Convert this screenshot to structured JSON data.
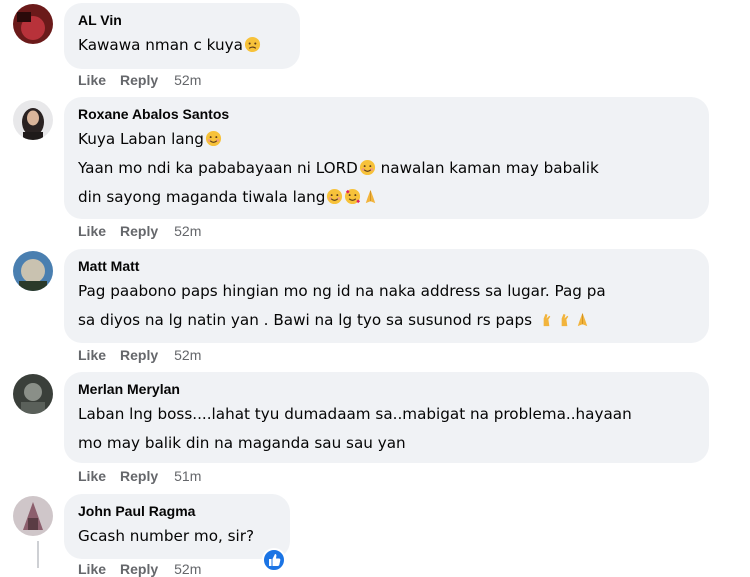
{
  "comments": [
    {
      "author": "AL Vin",
      "lines": [
        "Kawawa nman c kuya"
      ],
      "actions": {
        "like": "Like",
        "reply": "Reply",
        "time": "52m"
      }
    },
    {
      "author": "Roxane Abalos Santos",
      "lines": [
        "Kuya Laban lang",
        "Yaan mo ndi ka pababayaan ni LORD",
        " nawalan kaman may babalik",
        "din sayong maganda tiwala lang"
      ],
      "actions": {
        "like": "Like",
        "reply": "Reply",
        "time": "52m"
      }
    },
    {
      "author": "Matt Matt",
      "lines": [
        "Pag paabono paps hingian mo ng id na naka address sa lugar. Pag pa",
        "sa diyos na lg natin yan . Bawi na lg tyo sa susunod rs paps"
      ],
      "actions": {
        "like": "Like",
        "reply": "Reply",
        "time": "52m"
      }
    },
    {
      "author": "Merlan Merylan",
      "lines": [
        "Laban lng boss....lahat tyu dumadaam sa..mabigat na problema..hayaan",
        "mo may balik din na maganda sau sau yan"
      ],
      "actions": {
        "like": "Like",
        "reply": "Reply",
        "time": "51m"
      }
    },
    {
      "author": "John Paul Ragma",
      "lines": [
        "Gcash number mo, sir?"
      ],
      "actions": {
        "like": "Like",
        "reply": "Reply",
        "time": "52m"
      }
    }
  ],
  "emoji_icons": [
    "disappointed-face-icon",
    "smiling-face-icon",
    "smiling-hearts-face-icon",
    "praying-hands-icon",
    "fingers-crossed-icon",
    "thumbs-up-reaction-icon"
  ],
  "colors": {
    "bubble": "#f0f2f5",
    "action_text": "#65676b",
    "reaction_blue": "#1b74e4"
  }
}
